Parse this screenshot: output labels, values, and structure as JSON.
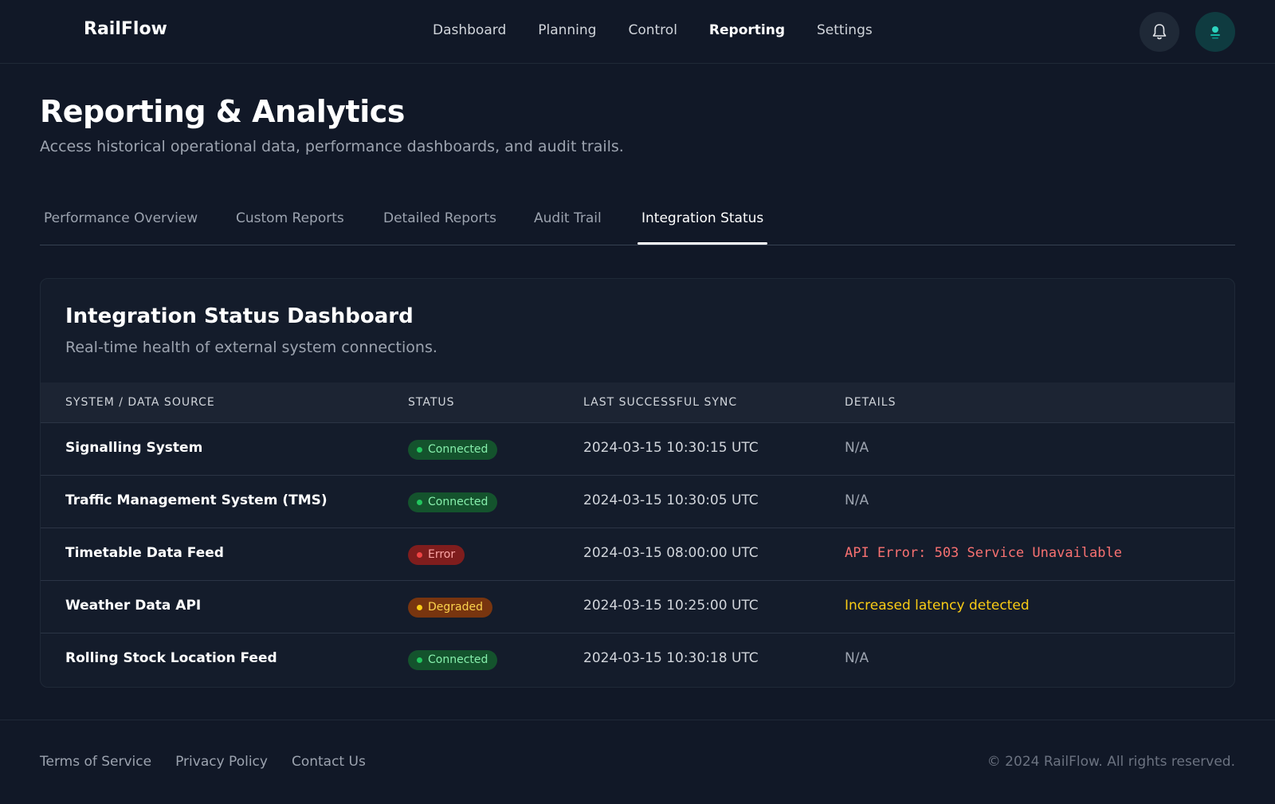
{
  "app": {
    "name": "RailFlow"
  },
  "nav": {
    "items": [
      {
        "label": "Dashboard"
      },
      {
        "label": "Planning"
      },
      {
        "label": "Control"
      },
      {
        "label": "Reporting",
        "active": true
      },
      {
        "label": "Settings"
      }
    ]
  },
  "header_icons": {
    "notifications": "bell-icon",
    "avatar": "user-avatar"
  },
  "page": {
    "title": "Reporting & Analytics",
    "subtitle": "Access historical operational data, performance dashboards, and audit trails."
  },
  "tabs": [
    {
      "label": "Performance Overview"
    },
    {
      "label": "Custom Reports"
    },
    {
      "label": "Detailed Reports"
    },
    {
      "label": "Audit Trail"
    },
    {
      "label": "Integration Status",
      "active": true
    }
  ],
  "card": {
    "title": "Integration Status Dashboard",
    "subtitle": "Real-time health of external system connections.",
    "columns": [
      "SYSTEM / DATA SOURCE",
      "STATUS",
      "LAST SUCCESSFUL SYNC",
      "DETAILS"
    ],
    "rows": [
      {
        "name": "Signalling System",
        "status": "Connected",
        "sync": "2024-03-15 10:30:15 UTC",
        "details": "N/A"
      },
      {
        "name": "Traffic Management System (TMS)",
        "status": "Connected",
        "sync": "2024-03-15 10:30:05 UTC",
        "details": "N/A"
      },
      {
        "name": "Timetable Data Feed",
        "status": "Error",
        "sync": "2024-03-15 08:00:00 UTC",
        "details": "API Error: 503 Service Unavailable"
      },
      {
        "name": "Weather Data API",
        "status": "Degraded",
        "sync": "2024-03-15 10:25:00 UTC",
        "details": "Increased latency detected"
      },
      {
        "name": "Rolling Stock Location Feed",
        "status": "Connected",
        "sync": "2024-03-15 10:30:18 UTC",
        "details": "N/A"
      }
    ]
  },
  "status_colors": {
    "connected": "#22c55e",
    "error": "#ef4444",
    "degraded": "#facc15"
  },
  "footer": {
    "links": [
      {
        "label": "Terms of Service"
      },
      {
        "label": "Privacy Policy"
      },
      {
        "label": "Contact Us"
      }
    ],
    "copyright": "© 2024 RailFlow. All rights reserved."
  }
}
